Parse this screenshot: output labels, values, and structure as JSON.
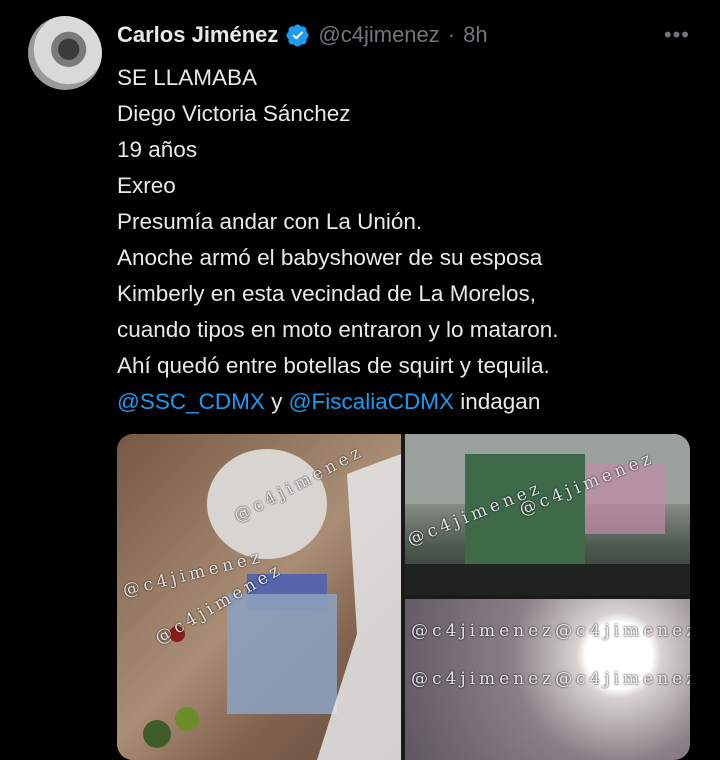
{
  "tweet": {
    "author_name": "Carlos Jiménez",
    "handle": "@c4jimenez",
    "separator": "·",
    "time": "8h",
    "more_icon": "more-dots-icon",
    "lines": [
      "SE LLAMABA",
      "Diego Victoria Sánchez",
      "19 años",
      "Exreo",
      "Presumía andar con La Unión.",
      "Anoche armó el babyshower de su esposa",
      "Kimberly en esta vecindad de La Morelos,",
      "cuando tipos en moto entraron y lo mataron.",
      "Ahí quedó entre botellas de squirt y tequila."
    ],
    "last_line": {
      "mention1": "@SSC_CDMX",
      "connector": " y ",
      "mention2": "@FiscaliaCDMX",
      "tail": " indagan"
    },
    "watermark": "@c4jimenez",
    "colors": {
      "accent": "#1d9bf0",
      "text": "#e7e9ea",
      "muted": "#71767b",
      "background": "#000000"
    }
  }
}
